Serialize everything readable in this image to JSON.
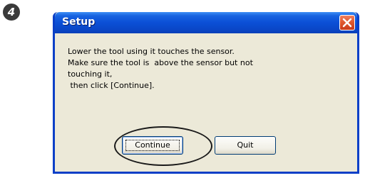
{
  "step": {
    "number": "4"
  },
  "dialog": {
    "title": "Setup",
    "message_lines": [
      "Lower the tool using it touches the sensor.",
      "Make sure the tool is  above the sensor but not",
      "touching it,",
      " then click [Continue]."
    ],
    "buttons": {
      "continue_label": "Continue",
      "quit_label": "Quit"
    }
  },
  "colors": {
    "titlebar": "#0b4fd6",
    "window_body": "#ece9d8",
    "close_button": "#e05a30"
  },
  "icons": {
    "close": "close-icon"
  }
}
